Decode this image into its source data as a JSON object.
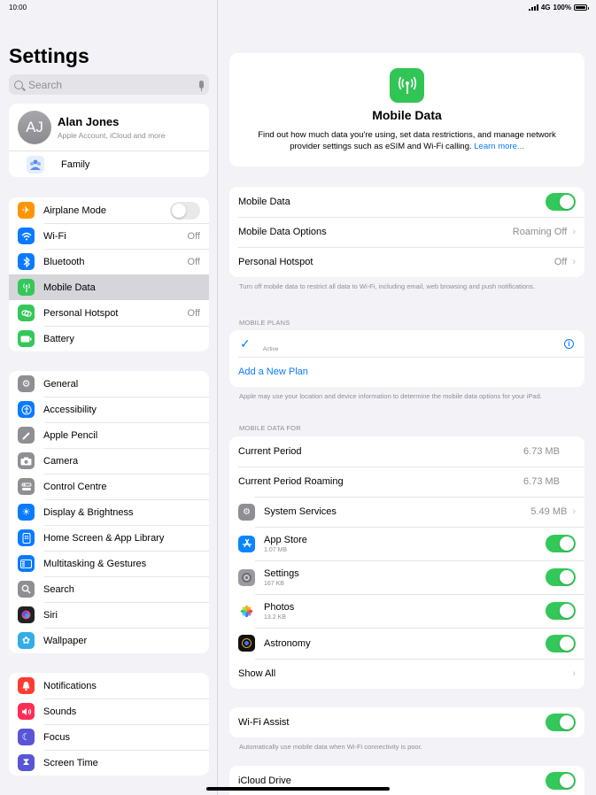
{
  "status": {
    "time": "10:00",
    "network": "4G",
    "battery": "100%"
  },
  "sidebar": {
    "title": "Settings",
    "search_placeholder": "Search",
    "profile": {
      "initials": "AJ",
      "name": "Alan Jones",
      "subtitle": "Apple Account, iCloud and more"
    },
    "family_label": "Family",
    "group1": [
      {
        "label": "Airplane Mode",
        "icon": "airplane-icon",
        "color": "#ff9500"
      },
      {
        "label": "Wi-Fi",
        "value": "Off",
        "icon": "wifi-icon",
        "color": "#0a7aff"
      },
      {
        "label": "Bluetooth",
        "value": "Off",
        "icon": "bluetooth-icon",
        "color": "#0a7aff"
      },
      {
        "label": "Mobile Data",
        "icon": "antenna-icon",
        "color": "#34c759"
      },
      {
        "label": "Personal Hotspot",
        "value": "Off",
        "icon": "hotspot-icon",
        "color": "#34c759"
      },
      {
        "label": "Battery",
        "icon": "battery-icon",
        "color": "#34c759"
      }
    ],
    "group2": [
      {
        "label": "General",
        "icon": "gear-icon",
        "color": "#8e8e93"
      },
      {
        "label": "Accessibility",
        "icon": "accessibility-icon",
        "color": "#0a7aff"
      },
      {
        "label": "Apple Pencil",
        "icon": "pencil-icon",
        "color": "#8e8e93"
      },
      {
        "label": "Camera",
        "icon": "camera-icon",
        "color": "#8e8e93"
      },
      {
        "label": "Control Centre",
        "icon": "control-centre-icon",
        "color": "#8e8e93"
      },
      {
        "label": "Display & Brightness",
        "icon": "sun-icon",
        "color": "#0a7aff"
      },
      {
        "label": "Home Screen & App Library",
        "icon": "home-screen-icon",
        "color": "#0a7aff"
      },
      {
        "label": "Multitasking & Gestures",
        "icon": "multitasking-icon",
        "color": "#0a7aff"
      },
      {
        "label": "Search",
        "icon": "search-icon",
        "color": "#8e8e93"
      },
      {
        "label": "Siri",
        "icon": "siri-icon",
        "color": "#222"
      },
      {
        "label": "Wallpaper",
        "icon": "flower-icon",
        "color": "#32ade6"
      }
    ],
    "group3": [
      {
        "label": "Notifications",
        "icon": "bell-icon",
        "color": "#ff3b30"
      },
      {
        "label": "Sounds",
        "icon": "speaker-icon",
        "color": "#ff2d55"
      },
      {
        "label": "Focus",
        "icon": "moon-icon",
        "color": "#5856d6"
      },
      {
        "label": "Screen Time",
        "icon": "hourglass-icon",
        "color": "#5856d6"
      }
    ]
  },
  "main": {
    "hero": {
      "title": "Mobile Data",
      "description": "Find out how much data you're using, set data restrictions, and manage network provider settings such as eSIM and Wi-Fi calling.",
      "link": "Learn more..."
    },
    "mobile_data_label": "Mobile Data",
    "options_label": "Mobile Data Options",
    "options_value": "Roaming Off",
    "hotspot_label": "Personal Hotspot",
    "hotspot_value": "Off",
    "footnote1": "Turn off mobile data to restrict all data to Wi-Fi, including email, web browsing and push notifications.",
    "plans_header": "MOBILE PLANS",
    "plan_status": "Active",
    "add_plan": "Add a New Plan",
    "footnote2": "Apple may use your location and device information to determine the mobile data options for your iPad.",
    "usage_header": "MOBILE DATA FOR",
    "current_period_label": "Current Period",
    "current_period_value": "6.73 MB",
    "roaming_label": "Current Period Roaming",
    "roaming_value": "6.73 MB",
    "system_services_label": "System Services",
    "system_services_value": "5.49 MB",
    "apps": [
      {
        "name": "App Store",
        "size": "1.07 MB",
        "icon": "app-store-icon"
      },
      {
        "name": "Settings",
        "size": "167 KB",
        "icon": "settings-icon"
      },
      {
        "name": "Photos",
        "size": "13.2 KB",
        "icon": "photos-icon"
      },
      {
        "name": "Astronomy",
        "size": "",
        "icon": "astronomy-icon"
      }
    ],
    "show_all": "Show All",
    "wifi_assist_label": "Wi-Fi Assist",
    "wifi_assist_note": "Automatically use mobile data when Wi-Fi connectivity is poor.",
    "icloud_drive_label": "iCloud Drive"
  }
}
